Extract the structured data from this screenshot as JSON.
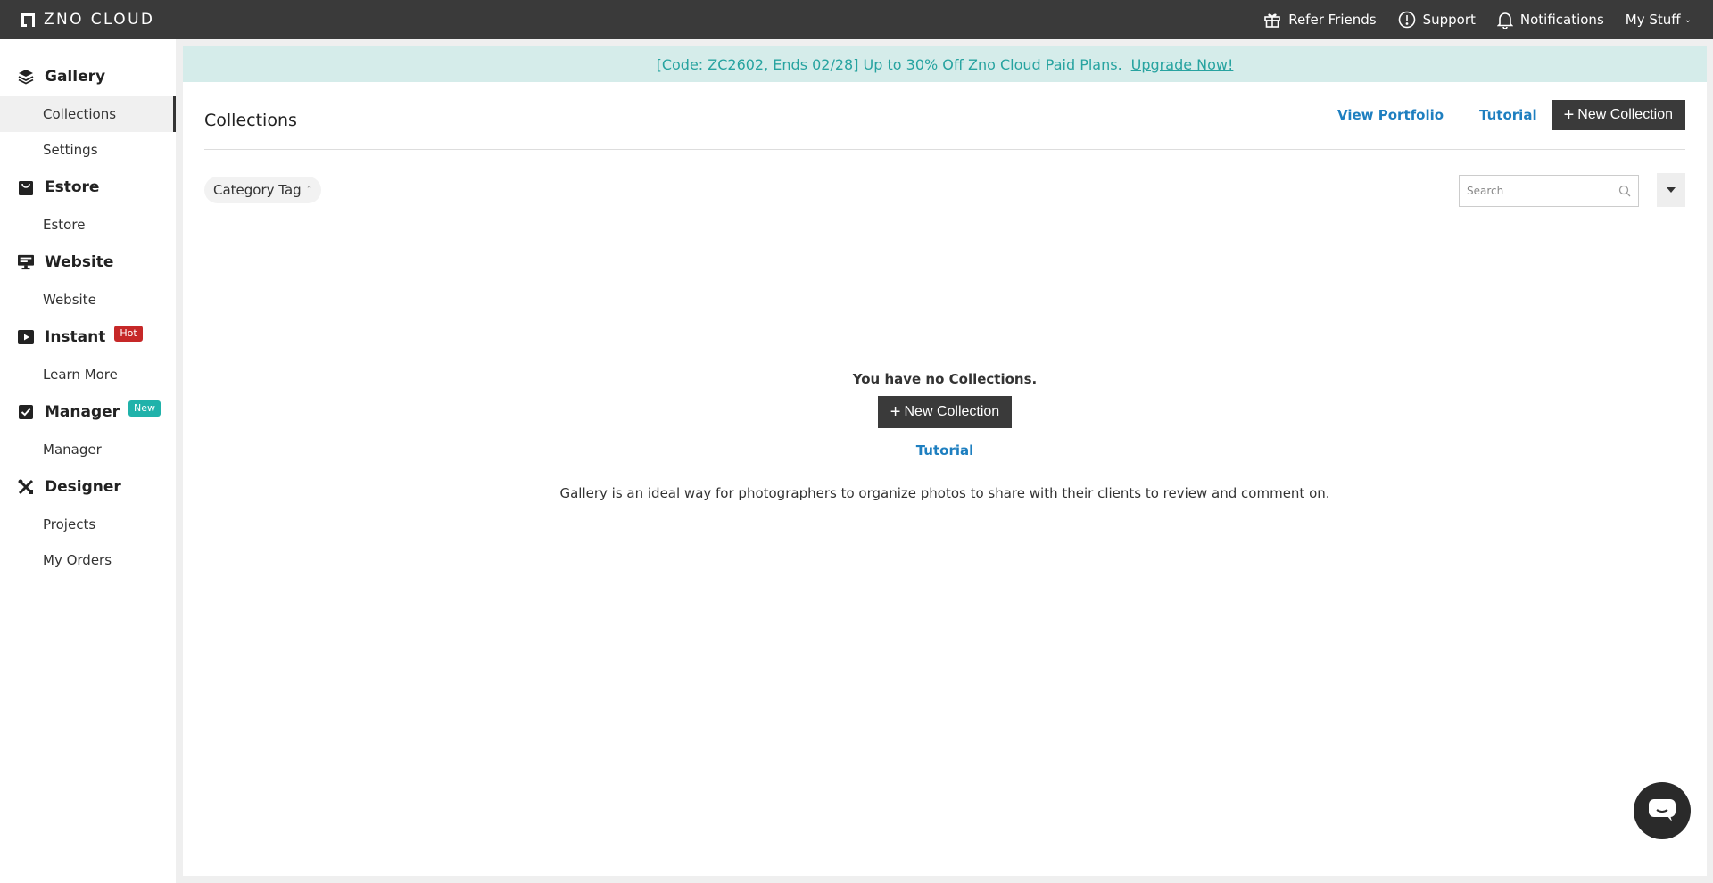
{
  "brand": {
    "logo_text": "ZNO CLOUD"
  },
  "topnav": {
    "refer": {
      "label": "Refer Friends",
      "icon": "gift-icon"
    },
    "support": {
      "label": "Support",
      "icon": "alert-circle-icon"
    },
    "notifications": {
      "label": "Notifications",
      "icon": "bell-icon"
    },
    "my_stuff": {
      "label": "My Stuff",
      "icon": "chevron-down-icon"
    }
  },
  "sidebar": {
    "sections": [
      {
        "title": "Gallery",
        "icon": "layers-icon",
        "items": [
          "Collections",
          "Settings"
        ]
      },
      {
        "title": "Estore",
        "icon": "store-icon",
        "items": [
          "Estore"
        ]
      },
      {
        "title": "Website",
        "icon": "monitor-icon",
        "items": [
          "Website"
        ]
      },
      {
        "title": "Instant",
        "icon": "video-icon",
        "badge": "Hot",
        "badge_color": "#c62828",
        "items": [
          "Learn More"
        ]
      },
      {
        "title": "Manager",
        "icon": "checkbox-icon",
        "badge": "New",
        "badge_color": "#20b2aa",
        "items": [
          "Manager"
        ]
      },
      {
        "title": "Designer",
        "icon": "tools-icon",
        "items": [
          "Projects",
          "My Orders"
        ]
      }
    ],
    "active_item": "Collections"
  },
  "promo": {
    "text": "[Code: ZC2602, Ends 02/28] Up to 30% Off Zno Cloud Paid Plans.",
    "link": "Upgrade Now!"
  },
  "page": {
    "title": "Collections",
    "view_portfolio": "View Portfolio",
    "tutorial": "Tutorial",
    "new_collection": "New Collection"
  },
  "filter": {
    "category_tag": "Category Tag",
    "search_placeholder": "Search"
  },
  "empty_state": {
    "message": "You have no Collections.",
    "new_collection": "New Collection",
    "tutorial": "Tutorial",
    "description": "Gallery is an ideal way for photographers to organize photos to share with their clients to review and comment on."
  },
  "colors": {
    "topbar": "#3a3a3a",
    "link": "#1e7fc0",
    "promo_bg": "#d5ecea",
    "promo_text": "#27a3a0"
  }
}
